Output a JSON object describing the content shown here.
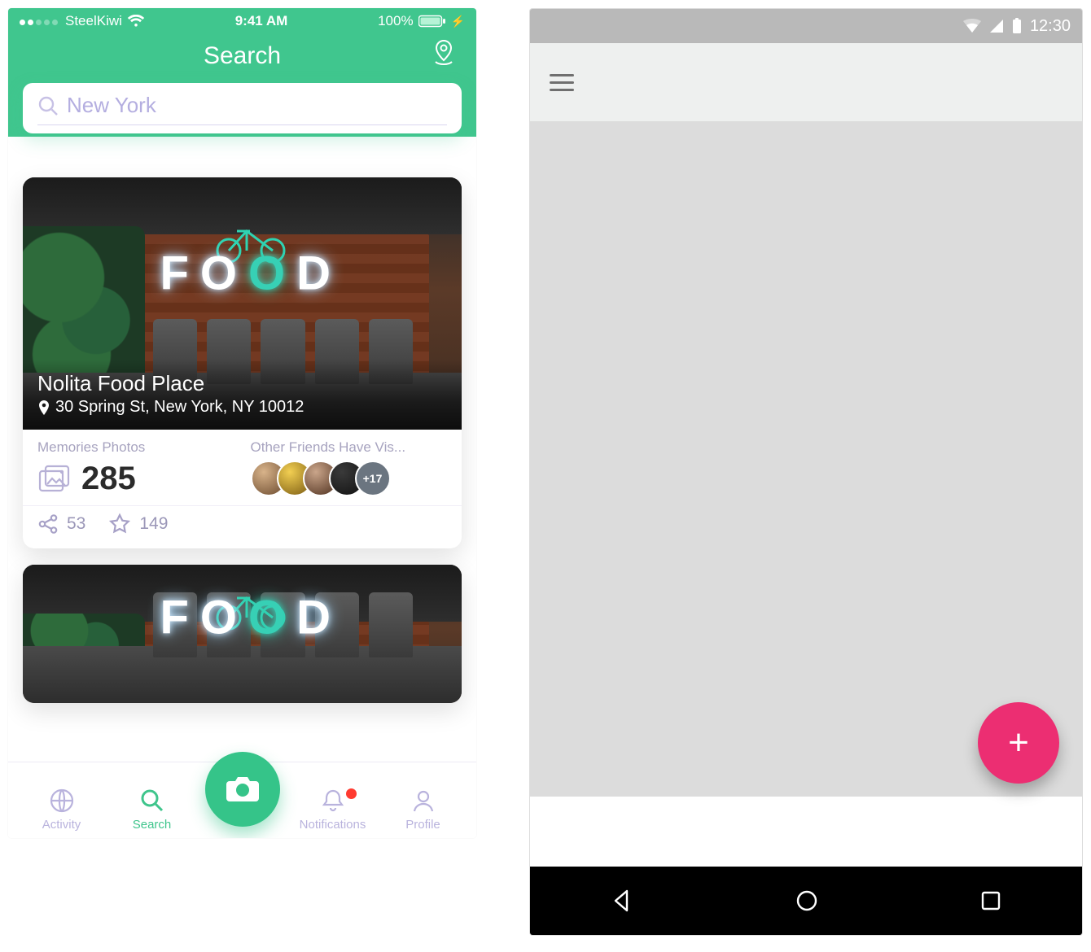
{
  "ios": {
    "status": {
      "carrier": "SteelKiwi",
      "time": "9:41 AM",
      "battery": "100%"
    },
    "title": "Search",
    "search": {
      "placeholder": "New York",
      "value": "New York"
    },
    "place": {
      "name": "Nolita Food Place",
      "address": "30 Spring St, New York, NY 10012",
      "neon_text_parts": [
        "F",
        "O",
        "O",
        "D"
      ],
      "memories_label": "Memories Photos",
      "memories_count": "285",
      "friends_label": "Other Friends Have Vis...",
      "friends_more": "+17",
      "shares": "53",
      "favorites": "149"
    },
    "tabs": {
      "activity": "Activity",
      "search": "Search",
      "notifications": "Notifications",
      "profile": "Profile"
    }
  },
  "android": {
    "status": {
      "time": "12:30"
    },
    "fab_label": "+"
  }
}
